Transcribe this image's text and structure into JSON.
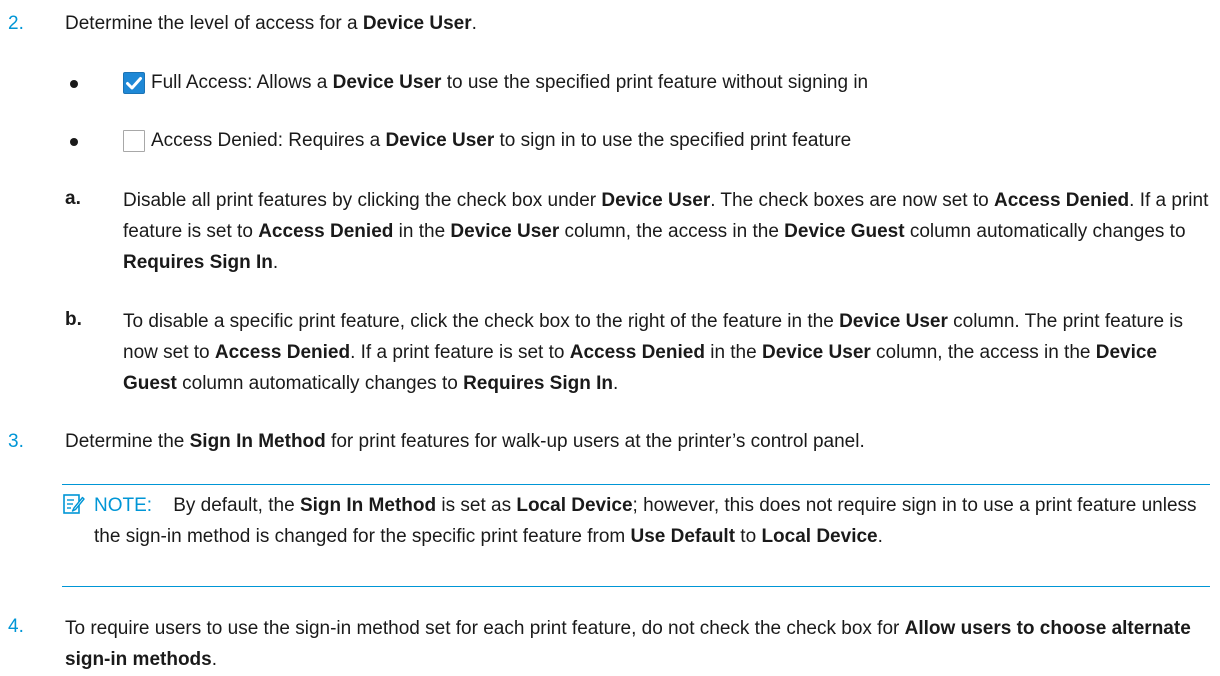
{
  "step2": {
    "number": "2.",
    "text_pre": "Determine the level of access for a ",
    "text_bold": "Device User",
    "text_post": "."
  },
  "bullets": [
    {
      "checkbox_state": "checked",
      "pre": "Full Access: Allows a ",
      "bold": "Device User",
      "post": " to use the specified print feature without signing in"
    },
    {
      "checkbox_state": "unchecked",
      "pre": "Access Denied: Requires a ",
      "bold": "Device User",
      "post": " to sign in to use the specified print feature"
    }
  ],
  "sub_a": {
    "letter": "a.",
    "t1": "Disable all print features by clicking the check box under ",
    "b1": "Device User",
    "t2": ". The check boxes are now set to ",
    "b2": "Access Denied",
    "t3": ". If a print feature is set to ",
    "b3": "Access Denied",
    "t4": " in the ",
    "b4": "Device User",
    "t5": " column, the access in the ",
    "b5": "Device Guest",
    "t6": " column automatically changes to ",
    "b6": "Requires Sign In",
    "t7": "."
  },
  "sub_b": {
    "letter": "b.",
    "t1": "To disable a specific print feature, click the check box to the right of the feature in the ",
    "b1": "Device User",
    "t2": " column. The print feature is now set to ",
    "b2": "Access Denied",
    "t3": ". If a print feature is set to ",
    "b3": "Access Denied",
    "t4": " in the ",
    "b4": "Device User",
    "t5": " column, the access in the ",
    "b5": "Device Guest",
    "t6": " column automatically changes to ",
    "b6": "Requires Sign In",
    "t7": "."
  },
  "step3": {
    "number": "3.",
    "t1": "Determine the ",
    "b1": "Sign In Method",
    "t2": " for print features for walk-up users at the printer’s control panel."
  },
  "note": {
    "label": "NOTE:",
    "t1": "By default, the ",
    "b1": "Sign In Method",
    "t2": " is set as ",
    "b2": "Local Device",
    "t3": "; however, this does not require sign in to use a print feature unless the sign-in method is changed for the specific print feature from ",
    "b3": "Use Default",
    "t4": " to ",
    "b4": "Local Device",
    "t5": "."
  },
  "step4": {
    "number": "4.",
    "t1": "To require users to use the sign-in method set for each print feature, do not check the check box for ",
    "b1": "Allow users to choose alternate sign-in methods",
    "t2": "."
  },
  "colors": {
    "accent": "#0096d6",
    "checkbox_fill": "#1e88d6",
    "text": "#1a1a1a"
  },
  "icons": {
    "checked": "checkbox-checked-icon",
    "unchecked": "checkbox-unchecked-icon",
    "note": "note-pencil-icon"
  }
}
